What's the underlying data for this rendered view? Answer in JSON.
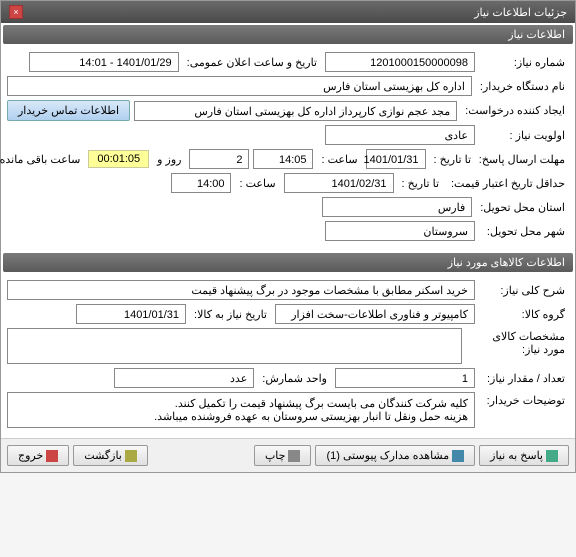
{
  "window": {
    "title": "جزئیات اطلاعات نیاز",
    "close": "×"
  },
  "section1": {
    "header": "اطلاعات نیاز"
  },
  "fields": {
    "need_no_label": "شماره نیاز:",
    "need_no": "1201000150000098",
    "announce_label": "تاریخ و ساعت اعلان عمومی:",
    "announce_value": "1401/01/29 - 14:01",
    "buyer_label": "نام دستگاه خریدار:",
    "buyer_value": "اداره کل بهزیستی استان فارس",
    "requester_label": "ایجاد کننده درخواست:",
    "requester_value": "مجد عجم نوازی کارپرداز اداره کل بهزیستی استان فارس",
    "contact_btn": "اطلاعات تماس خریدار",
    "priority_label": "اولویت نیاز :",
    "priority_value": "عادی",
    "deadline_label": "مهلت ارسال پاسخ:",
    "to_date_label": "تا تاریخ :",
    "deadline_date": "1401/01/31",
    "time_label": "ساعت :",
    "deadline_time": "14:05",
    "days_val": "2",
    "days_and": "روز و",
    "remaining_time": "00:01:05",
    "remaining_label": "ساعت باقی مانده",
    "min_valid_label": "حداقل تاریخ اعتبار قیمت:",
    "min_valid_date": "1401/02/31",
    "min_valid_time": "14:00",
    "province_label": "استان محل تحویل:",
    "province_value": "فارس",
    "city_label": "شهر محل تحویل:",
    "city_value": "سروستان"
  },
  "section2": {
    "header": "اطلاعات کالاهای مورد نیاز"
  },
  "goods": {
    "desc_label": "شرح کلی نیاز:",
    "desc_value": "خرید اسکنر مطابق با مشخصات موجود در برگ پیشنهاد قیمت",
    "group_label": "گروه کالا:",
    "group_value": "کامپیوتر و فناوری اطلاعات-سخت افزار",
    "need_date_label": "تاریخ نیاز به کالا:",
    "need_date_value": "1401/01/31",
    "spec_label": "مشخصات کالای مورد نیاز:",
    "spec_value": "",
    "qty_label": "تعداد / مقدار نیاز:",
    "qty_value": "1",
    "unit_label": "واحد شمارش:",
    "unit_value": "عدد",
    "notes_label": "توضیحات خریدار:",
    "notes_value": "کلیه شرکت کنندگان می بایست برگ پیشنهاد قیمت را تکمیل کنند.\nهزینه حمل ونقل تا انبار بهزیستی سروستان به عهده فروشنده میباشد."
  },
  "footer": {
    "respond": "پاسخ به نیاز",
    "attachments": "مشاهده مدارک پیوستی (1)",
    "print": "چاپ",
    "back": "بازگشت",
    "exit": "خروج"
  }
}
